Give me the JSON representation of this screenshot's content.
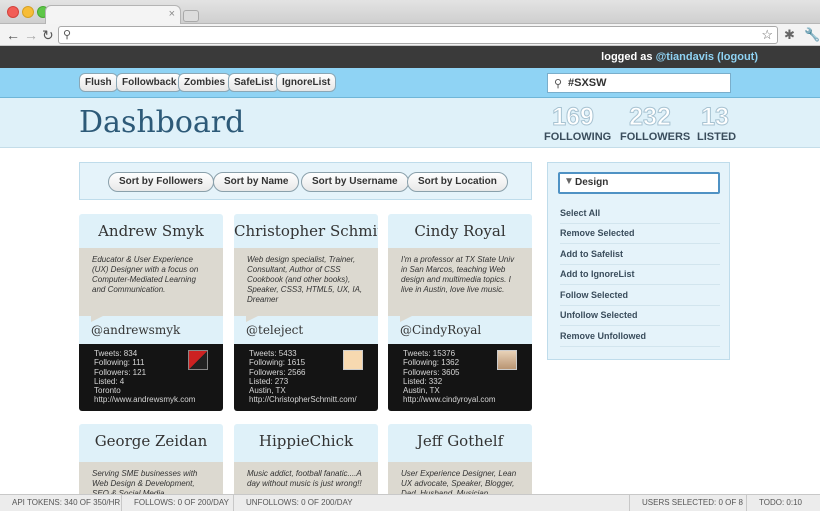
{
  "browser": {
    "tab_close": "×"
  },
  "userbar": {
    "prefix": "logged as",
    "username": "@tiandavis",
    "logout": "(logout)"
  },
  "menu": {
    "buttons": [
      "Flush",
      "Followback",
      "Zombies",
      "SafeList",
      "IgnoreList"
    ],
    "search_value": "#SXSW"
  },
  "dashboard": {
    "title": "Dashboard",
    "stats": [
      {
        "num": "169",
        "label": "FOLLOWING"
      },
      {
        "num": "232",
        "label": "FOLLOWERS"
      },
      {
        "num": "13",
        "label": "LISTED"
      }
    ]
  },
  "sort": {
    "buttons": [
      "Sort by Followers",
      "Sort by Name",
      "Sort by Username",
      "Sort by Location"
    ]
  },
  "cards": [
    {
      "name": "Andrew Smyk",
      "bio": "Educator & User Experience (UX) Designer with a focus on Computer-Mediated Learning and Communication.",
      "handle": "@andrewsmyk",
      "tweets": "Tweets: 834",
      "following": "Following: 111",
      "followers": "Followers: 121",
      "listed": "Listed: 4",
      "location": "Toronto",
      "url": "http://www.andrewsmyk.com"
    },
    {
      "name": "Christopher Schmitt",
      "bio": "Web design specialist, Trainer, Consultant, Author of CSS Cookbook (and other books), Speaker, CSS3, HTML5, UX, IA, Dreamer",
      "handle": "@teleject",
      "tweets": "Tweets: 5433",
      "following": "Following: 1615",
      "followers": "Followers: 2566",
      "listed": "Listed: 273",
      "location": "Austin, TX",
      "url": "http://ChristopherSchmitt.com/"
    },
    {
      "name": "Cindy Royal",
      "bio": "I'm a professor at TX State Univ in San Marcos, teaching Web design and multimedia topics. I live in Austin, love live music.",
      "handle": "@CindyRoyal",
      "tweets": "Tweets: 15376",
      "following": "Following: 1362",
      "followers": "Followers: 3605",
      "listed": "Listed: 332",
      "location": "Austin, TX",
      "url": "http://www.cindyroyal.com"
    },
    {
      "name": "George Zeidan",
      "bio": "Serving SME businesses with Web Design & Development, SEO & Social Media"
    },
    {
      "name": "HippieChick",
      "bio": "Music addict, football fanatic....A day without music is just wrong!!"
    },
    {
      "name": "Jeff Gothelf",
      "bio": "User Experience Designer, Lean UX advocate, Speaker, Blogger, Dad, Husband, Musician, Director"
    }
  ],
  "side_panel": {
    "filter_value": "Design",
    "items": [
      "Select All",
      "Remove Selected",
      "Add to Safelist",
      "Add to IgnoreList",
      "Follow Selected",
      "Unfollow Selected",
      "Remove Unfollowed"
    ]
  },
  "statusbar": {
    "api_tokens": "API TOKENS: 340 OF 350/HR",
    "follows": "FOLLOWS: 0 OF 200/DAY",
    "unfollows": "UNFOLLOWS: 0 OF 200/DAY",
    "users_selected": "USERS SELECTED: 0 OF 8",
    "todo": "TODO: 0:10"
  }
}
